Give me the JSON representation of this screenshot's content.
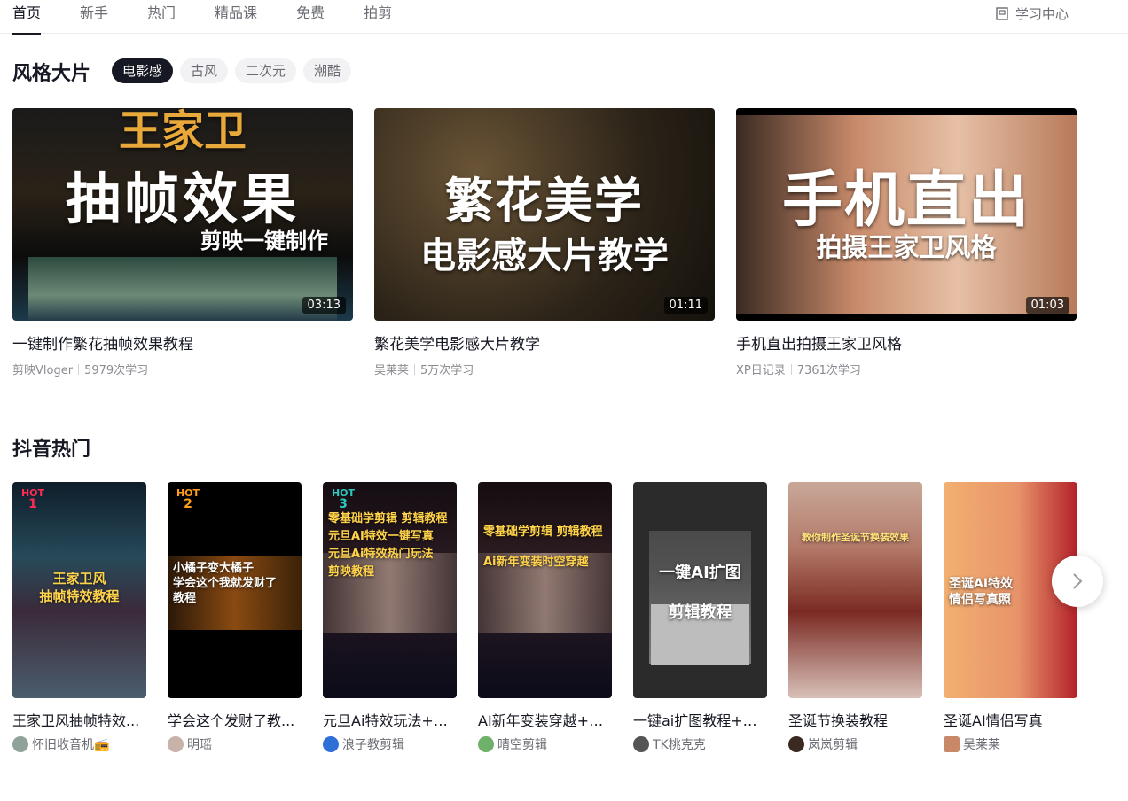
{
  "nav": {
    "tabs": [
      "首页",
      "新手",
      "热门",
      "精品课",
      "免费",
      "拍剪"
    ],
    "learning_center": "学习中心"
  },
  "style_section": {
    "title": "风格大片",
    "chips": [
      "电影感",
      "古风",
      "二次元",
      "潮酷"
    ],
    "videos": [
      {
        "overlay_top": "王家卫",
        "overlay_main": "抽帧效果",
        "overlay_sub": "剪映一键制作",
        "duration": "03:13",
        "title": "一键制作繁花抽帧效果教程",
        "author": "剪映Vloger",
        "views": "5979次学习"
      },
      {
        "overlay_main": "繁花美学",
        "overlay_sub": "电影感大片教学",
        "duration": "01:11",
        "title": "繁花美学电影感大片教学",
        "author": "吴莱莱",
        "views": "5万次学习"
      },
      {
        "overlay_main": "手机直出",
        "overlay_sub": "拍摄王家卫风格",
        "duration": "01:03",
        "title": "手机直出拍摄王家卫风格",
        "author": "XP日记录",
        "views": "7361次学习"
      }
    ]
  },
  "douyin_section": {
    "title": "抖音热门",
    "hot_label": "HOT",
    "videos": [
      {
        "rank": "1",
        "overlay": "王家卫风\n抽帧特效教程",
        "title": "王家卫风抽帧特效...",
        "author": "怀旧收音机📻"
      },
      {
        "rank": "2",
        "overlay": "小橘子变大橘子\n学会这个我就发财了\n教程",
        "title": "学会这个发财了教...",
        "author": "明瑶"
      },
      {
        "rank": "3",
        "overlay": "零基础学剪辑 剪辑教程\n元旦AI特效一键写真\n元旦Ai特效热门玩法\n剪映教程",
        "title": "元旦Ai特效玩法+素...",
        "author": "浪子教剪辑"
      },
      {
        "overlay": "零基础学剪辑 剪辑教程\nAi新年变装时空穿越",
        "title": "AI新年变装穿越+素...",
        "author": "晴空剪辑"
      },
      {
        "overlay": "一键AI扩图\n剪辑教程",
        "title": "一键ai扩图教程+素材",
        "author": "TK桃克克"
      },
      {
        "overlay": "教你制作圣诞节换装效果",
        "title": "圣诞节换装教程",
        "author": "岚岚剪辑"
      },
      {
        "overlay": "圣诞AI特效\n情侣写真照",
        "title": "圣诞AI情侣写真",
        "author": "吴莱莱"
      }
    ]
  }
}
